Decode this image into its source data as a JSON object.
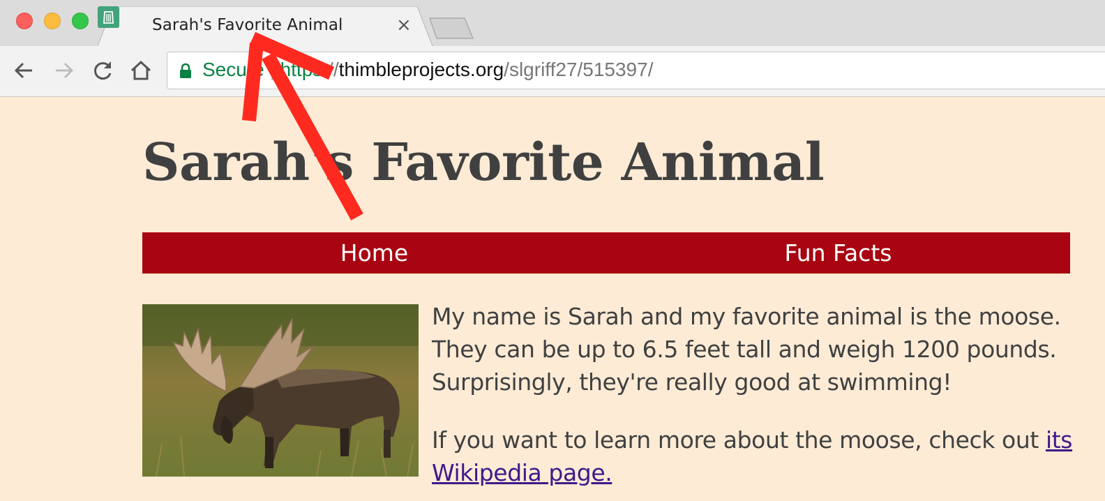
{
  "window": {
    "controls": [
      "close",
      "minimize",
      "maximize"
    ]
  },
  "tab": {
    "title": "Sarah's Favorite Animal",
    "close_glyph": "×",
    "favicon": "thimble-icon"
  },
  "toolbar": {
    "buttons": [
      "back-icon",
      "forward-icon",
      "reload-icon",
      "home-icon"
    ]
  },
  "address_bar": {
    "security_label": "Secure",
    "separator": "|",
    "scheme": "https:",
    "slashes": "//",
    "host": "thimbleprojects.org",
    "path": "/slgriff27/515397/"
  },
  "page": {
    "title": "Sarah's Favorite Animal",
    "nav": [
      {
        "label": "Home"
      },
      {
        "label": "Fun Facts"
      }
    ],
    "image": "moose-photo",
    "paragraph1": "My name is Sarah and my favorite animal is the moose. They can be up to 6.5 feet tall and weigh 1200 pounds. Surprisingly, they're really good at swimming!",
    "paragraph2_text": "If you want to learn more about the moose, check out ",
    "paragraph2_link": "its Wikipedia page."
  },
  "colors": {
    "page_background": "#fdebd6",
    "nav_background": "#a80411",
    "heading_text": "#404040",
    "link": "#3d1a8a",
    "secure_green": "#0b8043",
    "annotation_arrow": "#ff2a1f"
  }
}
